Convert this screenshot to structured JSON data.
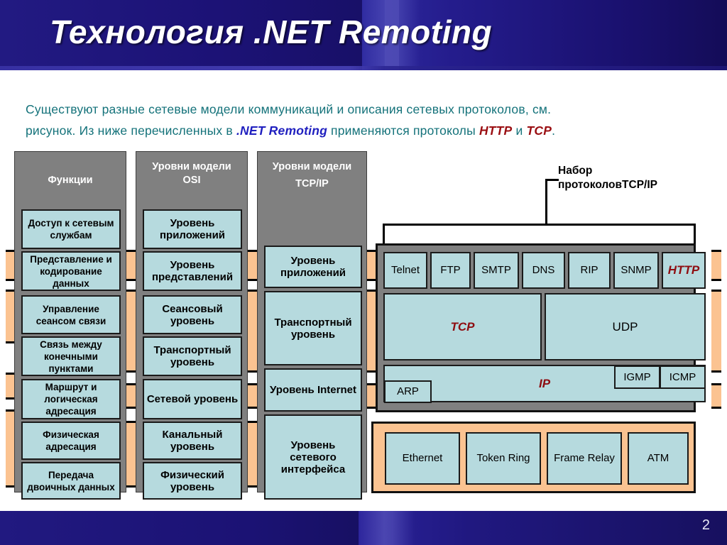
{
  "header": {
    "title": "Технология .NET Remoting"
  },
  "footer": {
    "page_number": "2"
  },
  "lead": {
    "line1_a": "Существуют разные сетевые модели коммуникаций и описания сетевых протоколов, см.",
    "line2_a": "рисунок. Из ниже перечисленных в ",
    "line2_em": ".NET Remoting",
    "line2_b": " применяются протоколы ",
    "line2_http": "HTTP",
    "line2_and": " и ",
    "line2_tcp": "TCP",
    "line2_end": "."
  },
  "columns": {
    "functions": {
      "title": "Функции",
      "cells": [
        "Доступ к сетевым службам",
        "Представление и кодирование данных",
        "Управление сеансом связи",
        "Связь между конечными пунктами",
        "Маршрут и логическая адресация",
        "Физическая адресация",
        "Передача двоичных данных"
      ]
    },
    "osi": {
      "title_line1": "Уровни модели",
      "title_line2": "OSI",
      "cells": [
        "Уровень приложений",
        "Уровень представлений",
        "Сеансовый уровень",
        "Транспортный уровень",
        "Сетевой уровень",
        "Канальный уровень",
        "Физический уровень"
      ]
    },
    "tcpip": {
      "title_line1": "Уровни модели",
      "title_line2": "TCP/IP",
      "cells": [
        "Уровень приложений",
        "Транспортный уровень",
        "Уровень Internet",
        "Уровень сетевого интерфейса"
      ]
    }
  },
  "protocol_suite": {
    "label_line1": "Набор",
    "label_line2": "протоколовTCP/IP",
    "application": [
      "Telnet",
      "FTP",
      "SMTP",
      "DNS",
      "RIP",
      "SNMP",
      "HTTP"
    ],
    "transport": [
      "TCP",
      "UDP"
    ],
    "internet": {
      "arp": "ARP",
      "ip": "IP",
      "igmp": "IGMP",
      "icmp": "ICMP"
    },
    "network_interface": [
      "Ethernet",
      "Token Ring",
      "Frame Relay",
      "ATM"
    ]
  },
  "colors": {
    "header_blue": "#1a1070",
    "cell_teal": "#b6dade",
    "panel_gray": "#808080",
    "ribbon_orange": "#fbc391",
    "accent_red": "#8e0d11",
    "lead_teal": "#14727a",
    "link_blue": "#1f1fbf"
  }
}
